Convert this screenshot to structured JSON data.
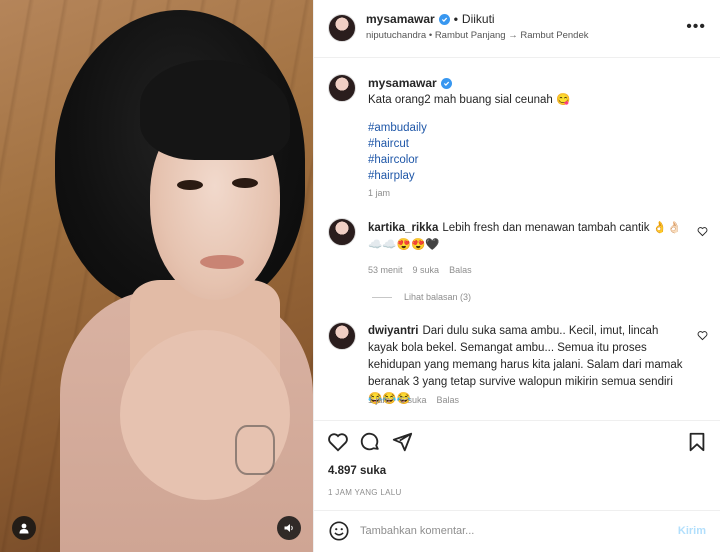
{
  "post_owner": {
    "username": "mysamawar",
    "follow_status": "Diikuti",
    "audio_line": "niputuchandra • Rambut Panjang → Rambut Pendek"
  },
  "caption": {
    "username": "mysamawar",
    "text": "Kata orang2 mah buang sial ceunah 😋",
    "hashtags": [
      "#ambudaily",
      "#haircut",
      "#haircolor",
      "#hairplay"
    ],
    "time": "1 jam"
  },
  "comments": [
    {
      "username": "kartika_rikka",
      "text": "Lebih fresh dan menawan tambah cantik 👌👌🏻☁️☁️😍😍🖤",
      "time": "53 menit",
      "likes": "9 suka",
      "reply": "Balas"
    },
    {
      "username": "dwiyantri",
      "text": "Dari dulu suka sama ambu.. Kecil, imut, lincah kayak bola bekel. Semangat ambu... Semua itu proses kehidupan yang memang harus kita jalani. Salam dari mamak beranak 3 yang tetap survive walopun mikirin semua sendiri 😂😂😂",
      "time": "1 jam",
      "likes": "6 suka",
      "reply": "Balas"
    }
  ],
  "view_replies": "Lihat balasan (3)",
  "likes_count": "4.897 suka",
  "posted_time": "1 JAM YANG LALU",
  "comment_box": {
    "placeholder": "Tambahkan komentar...",
    "post_label": "Kirim"
  },
  "colors": {
    "accent": "#3897f0",
    "hashtag": "#1f57a8",
    "muted": "#8e8e8e",
    "post_disabled": "#b2dffc"
  },
  "icons": [
    "user-tag-icon",
    "sound-icon",
    "more-icon",
    "verified-icon",
    "heart-icon",
    "comment-icon",
    "share-icon",
    "bookmark-icon",
    "emoji-icon"
  ]
}
